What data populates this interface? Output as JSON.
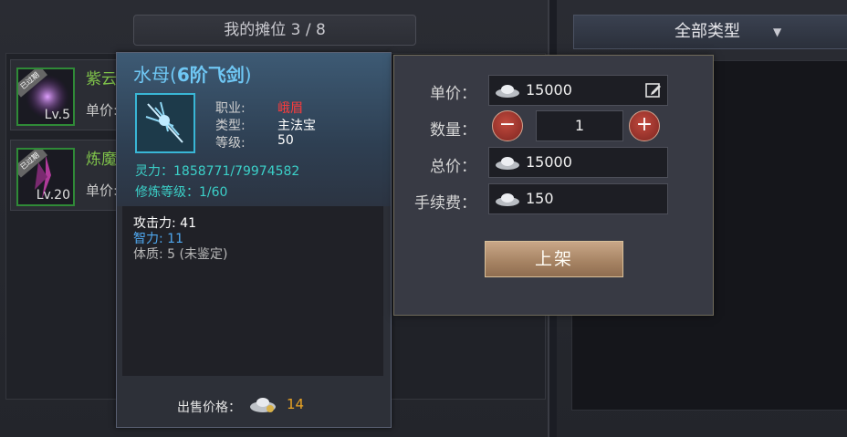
{
  "stall": {
    "title": "我的摊位 3 / 8",
    "items": [
      {
        "badge": "已过期",
        "level": "Lv.5",
        "name": "紫云",
        "price_label": "单价:"
      },
      {
        "badge": "已过期",
        "level": "Lv.20",
        "name": "炼魔",
        "price_label": "单价:"
      }
    ]
  },
  "filter": {
    "selected": "全部类型"
  },
  "tooltip": {
    "name": "水母(",
    "grade": "6阶飞剑",
    "name_close": ")",
    "fields": [
      {
        "key": "职业:",
        "value": "峨眉",
        "color": "#ff3b3b"
      },
      {
        "key": "类型:",
        "value": "主法宝",
        "color": "#ffffff"
      },
      {
        "key": "等级:",
        "value": "50",
        "color": "#ffffff"
      }
    ],
    "spirit": "灵力：1858771/79974582",
    "cultivation": "修炼等级：1/60",
    "attrs": [
      {
        "text": "攻击力: 41",
        "color": "#ffffff"
      },
      {
        "text": "智力: 11",
        "color": "#4fa8f0"
      },
      {
        "text": "体质: 5 (未鉴定)",
        "color": "#b8b8b8"
      }
    ],
    "sell_label": "出售价格：",
    "sell_price": "14"
  },
  "form": {
    "unit_label": "单价：",
    "unit_price": "15000",
    "qty_label": "数量：",
    "qty": "1",
    "minus": "−",
    "plus": "+",
    "total_label": "总价：",
    "total": "15000",
    "fee_label": "手续费：",
    "fee": "150",
    "submit": "上架"
  }
}
